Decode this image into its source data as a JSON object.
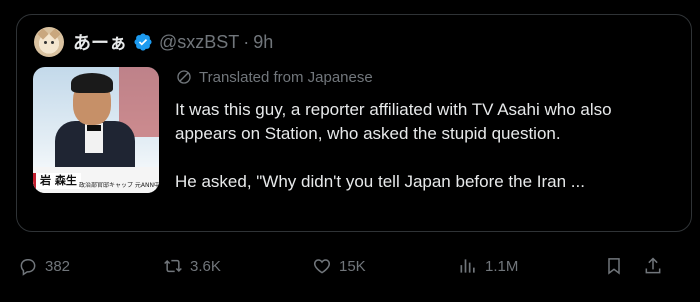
{
  "author": {
    "display_name": "あーぁ",
    "verified": true,
    "handle": "@sxzBST",
    "separator": "·",
    "time": "9h"
  },
  "translation": {
    "label": "Translated from Japanese"
  },
  "media": {
    "name_tag": "岩 森生",
    "caption": "政治部官邸キャップ 元ANN中 麻生政権から永田町を取材"
  },
  "tweet": {
    "paragraph_1": "It was this guy, a reporter affiliated with TV Asahi who also appears on Station, who asked the stupid question.",
    "paragraph_2": "He asked, \"Why didn't you tell Japan before the Iran ..."
  },
  "actions": {
    "replies": "382",
    "reposts": "3.6K",
    "likes": "15K",
    "views": "1.1M"
  },
  "colors": {
    "background": "#000000",
    "text_primary": "#e7e9ea",
    "text_secondary": "#71767b",
    "verified_blue": "#1d9bf0",
    "border": "#2f3336"
  },
  "icons": [
    "verified-badge-icon",
    "translate-icon",
    "reply-icon",
    "repost-icon",
    "like-icon",
    "views-icon",
    "bookmark-icon",
    "share-icon"
  ]
}
